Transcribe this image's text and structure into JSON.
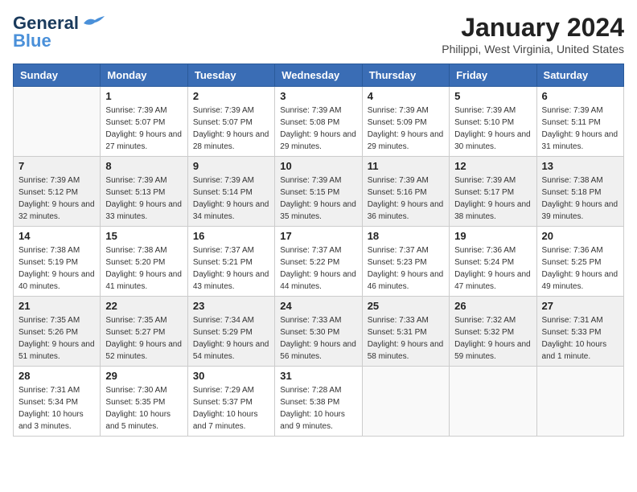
{
  "logo": {
    "line1": "General",
    "line2": "Blue"
  },
  "title": "January 2024",
  "subtitle": "Philippi, West Virginia, United States",
  "headers": [
    "Sunday",
    "Monday",
    "Tuesday",
    "Wednesday",
    "Thursday",
    "Friday",
    "Saturday"
  ],
  "weeks": [
    [
      {
        "num": "",
        "sunrise": "",
        "sunset": "",
        "daylight": ""
      },
      {
        "num": "1",
        "sunrise": "Sunrise: 7:39 AM",
        "sunset": "Sunset: 5:07 PM",
        "daylight": "Daylight: 9 hours and 27 minutes."
      },
      {
        "num": "2",
        "sunrise": "Sunrise: 7:39 AM",
        "sunset": "Sunset: 5:07 PM",
        "daylight": "Daylight: 9 hours and 28 minutes."
      },
      {
        "num": "3",
        "sunrise": "Sunrise: 7:39 AM",
        "sunset": "Sunset: 5:08 PM",
        "daylight": "Daylight: 9 hours and 29 minutes."
      },
      {
        "num": "4",
        "sunrise": "Sunrise: 7:39 AM",
        "sunset": "Sunset: 5:09 PM",
        "daylight": "Daylight: 9 hours and 29 minutes."
      },
      {
        "num": "5",
        "sunrise": "Sunrise: 7:39 AM",
        "sunset": "Sunset: 5:10 PM",
        "daylight": "Daylight: 9 hours and 30 minutes."
      },
      {
        "num": "6",
        "sunrise": "Sunrise: 7:39 AM",
        "sunset": "Sunset: 5:11 PM",
        "daylight": "Daylight: 9 hours and 31 minutes."
      }
    ],
    [
      {
        "num": "7",
        "sunrise": "Sunrise: 7:39 AM",
        "sunset": "Sunset: 5:12 PM",
        "daylight": "Daylight: 9 hours and 32 minutes."
      },
      {
        "num": "8",
        "sunrise": "Sunrise: 7:39 AM",
        "sunset": "Sunset: 5:13 PM",
        "daylight": "Daylight: 9 hours and 33 minutes."
      },
      {
        "num": "9",
        "sunrise": "Sunrise: 7:39 AM",
        "sunset": "Sunset: 5:14 PM",
        "daylight": "Daylight: 9 hours and 34 minutes."
      },
      {
        "num": "10",
        "sunrise": "Sunrise: 7:39 AM",
        "sunset": "Sunset: 5:15 PM",
        "daylight": "Daylight: 9 hours and 35 minutes."
      },
      {
        "num": "11",
        "sunrise": "Sunrise: 7:39 AM",
        "sunset": "Sunset: 5:16 PM",
        "daylight": "Daylight: 9 hours and 36 minutes."
      },
      {
        "num": "12",
        "sunrise": "Sunrise: 7:39 AM",
        "sunset": "Sunset: 5:17 PM",
        "daylight": "Daylight: 9 hours and 38 minutes."
      },
      {
        "num": "13",
        "sunrise": "Sunrise: 7:38 AM",
        "sunset": "Sunset: 5:18 PM",
        "daylight": "Daylight: 9 hours and 39 minutes."
      }
    ],
    [
      {
        "num": "14",
        "sunrise": "Sunrise: 7:38 AM",
        "sunset": "Sunset: 5:19 PM",
        "daylight": "Daylight: 9 hours and 40 minutes."
      },
      {
        "num": "15",
        "sunrise": "Sunrise: 7:38 AM",
        "sunset": "Sunset: 5:20 PM",
        "daylight": "Daylight: 9 hours and 41 minutes."
      },
      {
        "num": "16",
        "sunrise": "Sunrise: 7:37 AM",
        "sunset": "Sunset: 5:21 PM",
        "daylight": "Daylight: 9 hours and 43 minutes."
      },
      {
        "num": "17",
        "sunrise": "Sunrise: 7:37 AM",
        "sunset": "Sunset: 5:22 PM",
        "daylight": "Daylight: 9 hours and 44 minutes."
      },
      {
        "num": "18",
        "sunrise": "Sunrise: 7:37 AM",
        "sunset": "Sunset: 5:23 PM",
        "daylight": "Daylight: 9 hours and 46 minutes."
      },
      {
        "num": "19",
        "sunrise": "Sunrise: 7:36 AM",
        "sunset": "Sunset: 5:24 PM",
        "daylight": "Daylight: 9 hours and 47 minutes."
      },
      {
        "num": "20",
        "sunrise": "Sunrise: 7:36 AM",
        "sunset": "Sunset: 5:25 PM",
        "daylight": "Daylight: 9 hours and 49 minutes."
      }
    ],
    [
      {
        "num": "21",
        "sunrise": "Sunrise: 7:35 AM",
        "sunset": "Sunset: 5:26 PM",
        "daylight": "Daylight: 9 hours and 51 minutes."
      },
      {
        "num": "22",
        "sunrise": "Sunrise: 7:35 AM",
        "sunset": "Sunset: 5:27 PM",
        "daylight": "Daylight: 9 hours and 52 minutes."
      },
      {
        "num": "23",
        "sunrise": "Sunrise: 7:34 AM",
        "sunset": "Sunset: 5:29 PM",
        "daylight": "Daylight: 9 hours and 54 minutes."
      },
      {
        "num": "24",
        "sunrise": "Sunrise: 7:33 AM",
        "sunset": "Sunset: 5:30 PM",
        "daylight": "Daylight: 9 hours and 56 minutes."
      },
      {
        "num": "25",
        "sunrise": "Sunrise: 7:33 AM",
        "sunset": "Sunset: 5:31 PM",
        "daylight": "Daylight: 9 hours and 58 minutes."
      },
      {
        "num": "26",
        "sunrise": "Sunrise: 7:32 AM",
        "sunset": "Sunset: 5:32 PM",
        "daylight": "Daylight: 9 hours and 59 minutes."
      },
      {
        "num": "27",
        "sunrise": "Sunrise: 7:31 AM",
        "sunset": "Sunset: 5:33 PM",
        "daylight": "Daylight: 10 hours and 1 minute."
      }
    ],
    [
      {
        "num": "28",
        "sunrise": "Sunrise: 7:31 AM",
        "sunset": "Sunset: 5:34 PM",
        "daylight": "Daylight: 10 hours and 3 minutes."
      },
      {
        "num": "29",
        "sunrise": "Sunrise: 7:30 AM",
        "sunset": "Sunset: 5:35 PM",
        "daylight": "Daylight: 10 hours and 5 minutes."
      },
      {
        "num": "30",
        "sunrise": "Sunrise: 7:29 AM",
        "sunset": "Sunset: 5:37 PM",
        "daylight": "Daylight: 10 hours and 7 minutes."
      },
      {
        "num": "31",
        "sunrise": "Sunrise: 7:28 AM",
        "sunset": "Sunset: 5:38 PM",
        "daylight": "Daylight: 10 hours and 9 minutes."
      },
      {
        "num": "",
        "sunrise": "",
        "sunset": "",
        "daylight": ""
      },
      {
        "num": "",
        "sunrise": "",
        "sunset": "",
        "daylight": ""
      },
      {
        "num": "",
        "sunrise": "",
        "sunset": "",
        "daylight": ""
      }
    ]
  ]
}
